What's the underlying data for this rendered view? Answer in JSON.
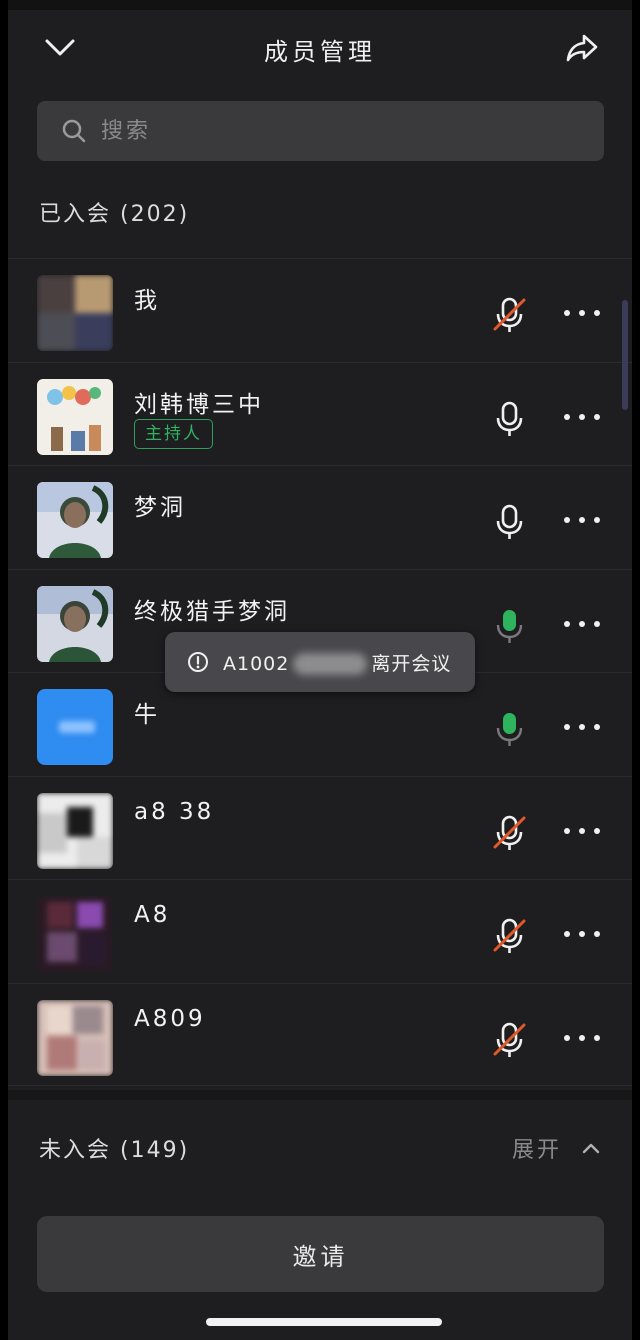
{
  "header": {
    "title": "成员管理",
    "back_icon": "chevron-down-icon",
    "share_icon": "share-icon"
  },
  "search": {
    "placeholder": "搜索"
  },
  "joined": {
    "label": "已入会 (202)"
  },
  "members": [
    {
      "name": "我",
      "mic": "muted",
      "badge": ""
    },
    {
      "name": "刘韩博三中",
      "mic": "on",
      "badge": "主持人"
    },
    {
      "name": "梦洞",
      "mic": "on",
      "badge": ""
    },
    {
      "name": "终极猎手梦洞",
      "mic": "active",
      "badge": ""
    },
    {
      "name": "牛",
      "mic": "active",
      "badge": ""
    },
    {
      "name": "a8 38",
      "mic": "muted",
      "badge": ""
    },
    {
      "name": "A8",
      "mic": "muted",
      "badge": ""
    },
    {
      "name": "A809",
      "mic": "muted",
      "badge": ""
    }
  ],
  "toast": {
    "prefix": "A1002",
    "suffix": "离开会议"
  },
  "not_joined": {
    "label": "未入会 (149)",
    "expand_label": "展开"
  },
  "invite": {
    "label": "邀请"
  },
  "colors": {
    "background": "#1e1e20",
    "muted_slash": "#e0592a",
    "active_mic": "#2fb35f",
    "host_badge": "#2fb35f"
  }
}
